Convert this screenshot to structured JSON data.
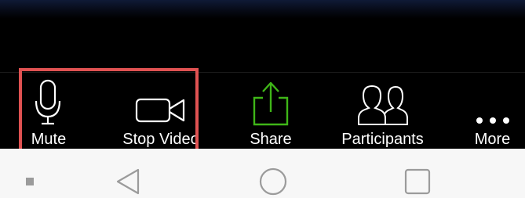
{
  "toolbar": {
    "mute_label": "Mute",
    "stop_video_label": "Stop Video",
    "share_label": "Share",
    "participants_label": "Participants",
    "more_label": "More"
  },
  "icons": {
    "mute": "microphone-icon",
    "stop_video": "video-camera-icon",
    "share": "share-upload-icon",
    "participants": "participants-icon",
    "more": "more-dots-icon",
    "nav_back": "back-triangle-icon",
    "nav_home": "home-circle-icon",
    "nav_recents": "recents-square-icon"
  },
  "colors": {
    "toolbar_background": "#000000",
    "share_icon": "#3fb618",
    "highlight_box": "#e05252",
    "navbar_background": "#f7f7f7",
    "navbar_icon": "#9b9b9b"
  }
}
